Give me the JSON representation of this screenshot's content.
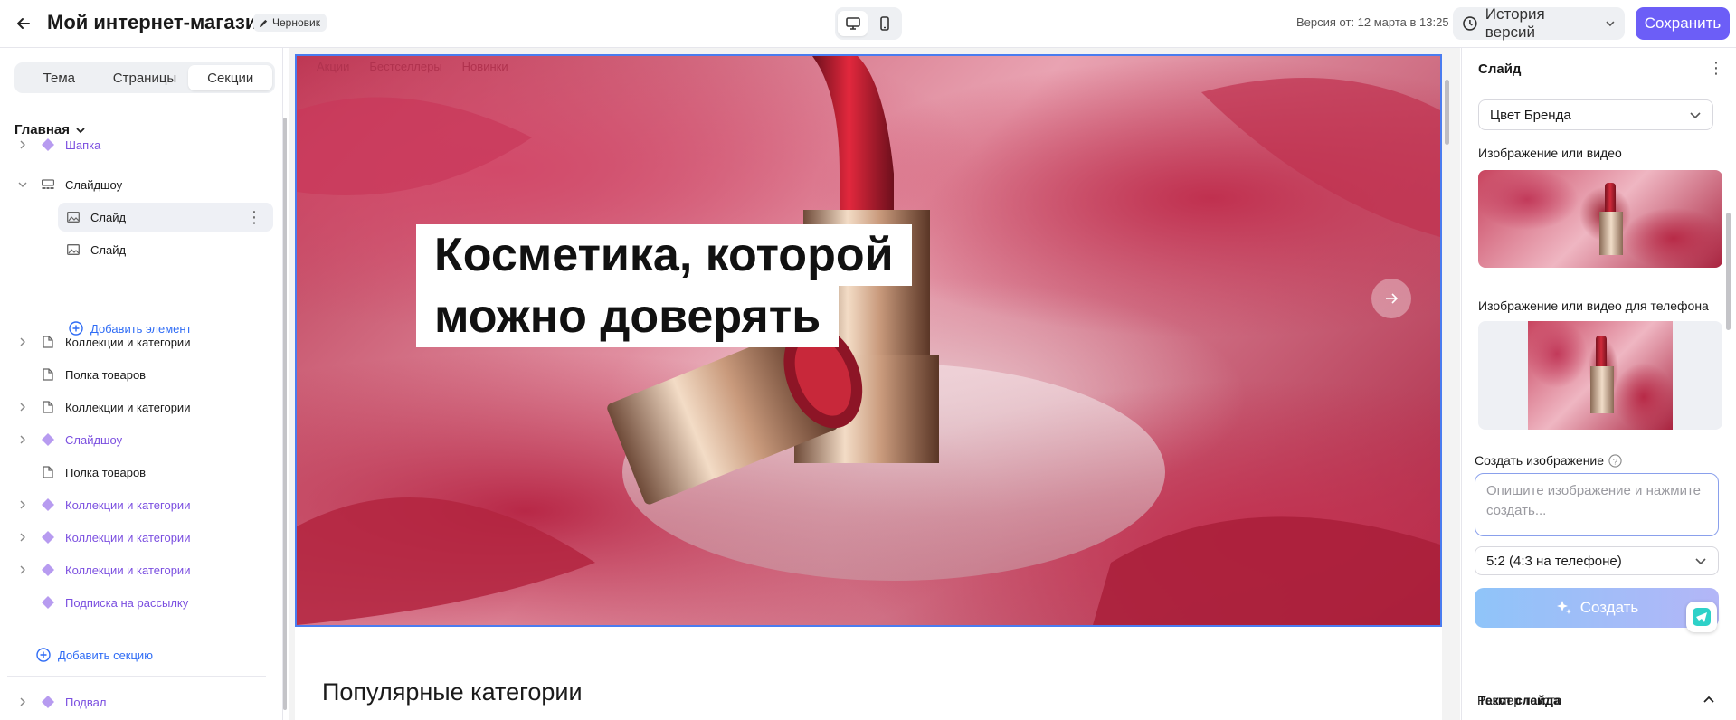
{
  "topbar": {
    "title": "Мой интернет-магазин",
    "draft_label": "Черновик",
    "version_text": "Версия от: 12 марта в 13:25",
    "history_label": "История версий",
    "save_label": "Сохранить"
  },
  "sidebar": {
    "tabs": [
      "Тема",
      "Страницы",
      "Секции"
    ],
    "active_tab": "Секции",
    "page": "Главная",
    "items": [
      {
        "label": "Шапка"
      },
      {
        "label": "Слайдшоу"
      },
      {
        "label": "Слайд"
      },
      {
        "label": "Слайд"
      },
      {
        "label": "Добавить элемент"
      },
      {
        "label": "Коллекции и категории"
      },
      {
        "label": "Полка товаров"
      },
      {
        "label": "Коллекции и категории"
      },
      {
        "label": "Слайдшоу"
      },
      {
        "label": "Полка товаров"
      },
      {
        "label": "Коллекции и категории"
      },
      {
        "label": "Коллекции и категории"
      },
      {
        "label": "Коллекции и категории"
      },
      {
        "label": "Подписка на рассылку"
      },
      {
        "label": "Добавить секцию"
      },
      {
        "label": "Подвал"
      }
    ]
  },
  "canvas": {
    "nav": [
      "Акции",
      "Бестселлеры",
      "Новинки"
    ],
    "hero_line1": "Косметика, которой",
    "hero_line2": "можно доверять",
    "popular_title": "Популярные категории"
  },
  "panel": {
    "title": "Слайд",
    "brand_select": "Цвет Бренда",
    "image_label": "Изображение или видео",
    "phone_image_label": "Изображение или видео для телефона",
    "create_image_label": "Создать изображение",
    "prompt_placeholder": "Опишите изображение и нажмите создать...",
    "ratio_select": "5:2 (4:3 на телефоне)",
    "create_label": "Создать",
    "slide_text_section": "Текст слайда",
    "text_size_label": "Размер текста"
  },
  "colors": {
    "accent": "#6c5ef7",
    "link": "#2f6cf5",
    "purple_item": "#7b4fe0",
    "selection": "#4a7cf0"
  }
}
